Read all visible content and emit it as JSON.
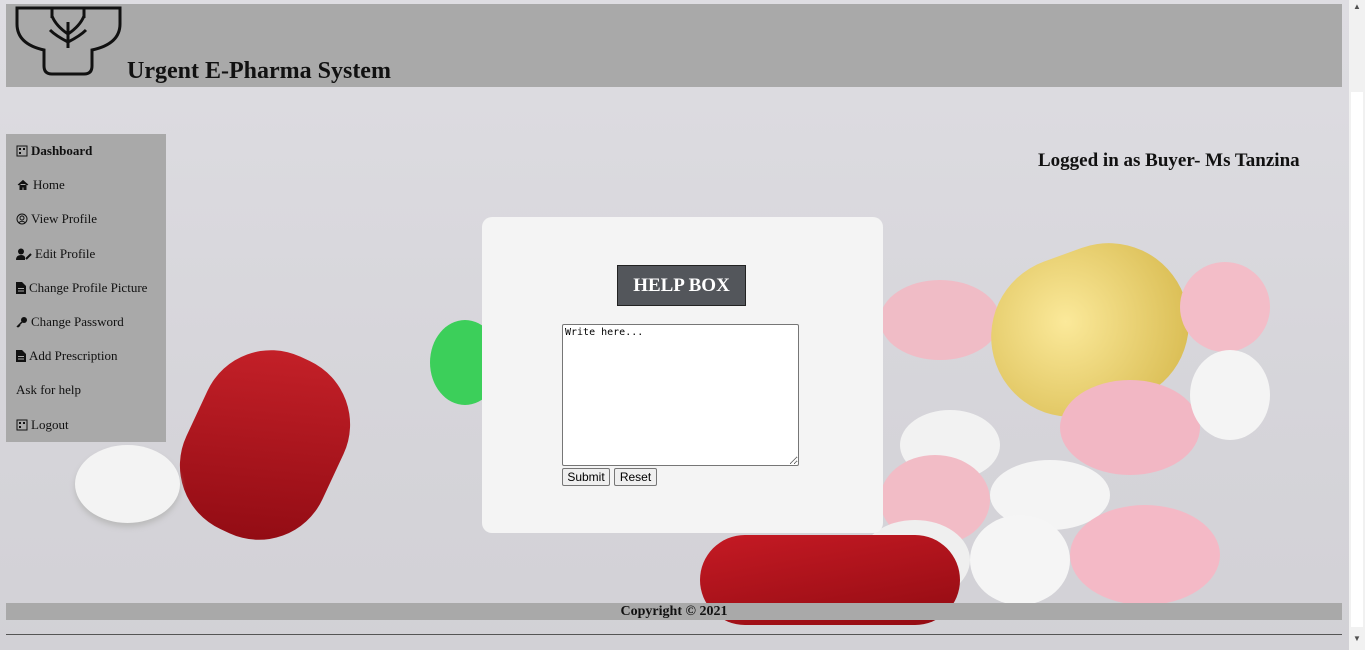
{
  "header": {
    "title": "Urgent E-Pharma System"
  },
  "sidebar": {
    "items": [
      {
        "label": "Dashboard",
        "icon": "dashboard-icon"
      },
      {
        "label": "Home",
        "icon": "home-icon"
      },
      {
        "label": "View Profile",
        "icon": "user-circle-icon"
      },
      {
        "label": "Edit Profile",
        "icon": "user-edit-icon"
      },
      {
        "label": "Change Profile Picture",
        "icon": "file-icon"
      },
      {
        "label": "Change Password",
        "icon": "key-icon"
      },
      {
        "label": "Add Prescription",
        "icon": "file-icon"
      },
      {
        "label": "Ask for help",
        "icon": ""
      },
      {
        "label": "Logout",
        "icon": "logout-icon"
      }
    ]
  },
  "status": {
    "logged_in": "Logged in as Buyer- Ms Tanzina"
  },
  "help": {
    "title": "HELP BOX",
    "textarea_value": "Write here...",
    "submit_label": "Submit",
    "reset_label": "Reset"
  },
  "footer": {
    "copyright": "Copyright © 2021"
  },
  "colors": {
    "bar": "#a9a9a9",
    "help_title_bg": "#53565b",
    "panel": "#f4f4f4"
  }
}
